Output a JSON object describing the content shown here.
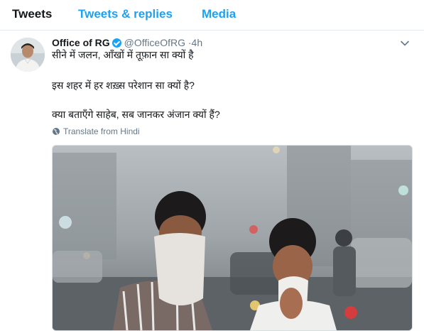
{
  "tabs": [
    {
      "label": "Tweets",
      "active": true
    },
    {
      "label": "Tweets & replies",
      "active": false
    },
    {
      "label": "Media",
      "active": false
    }
  ],
  "tweet": {
    "name": "Office of RG",
    "handle": "@OfficeOfRG",
    "separator": " ·",
    "time": "4h",
    "lines": [
      "सीने में जलन, आँखों में तूफ़ान सा क्यों है",
      "इस शहर में हर शख़्स परेशान सा क्यों है?",
      "क्या बताएँगे साहेब, सब जानकर अंजान क्यों हैं?"
    ],
    "translate_label": "Translate from Hindi",
    "icons": {
      "verified": "verified-badge-icon",
      "menu": "chevron-down-icon",
      "translate": "globe-icon"
    }
  },
  "colors": {
    "accent": "#1da1f2",
    "text": "#14171a",
    "secondary": "#657786"
  }
}
